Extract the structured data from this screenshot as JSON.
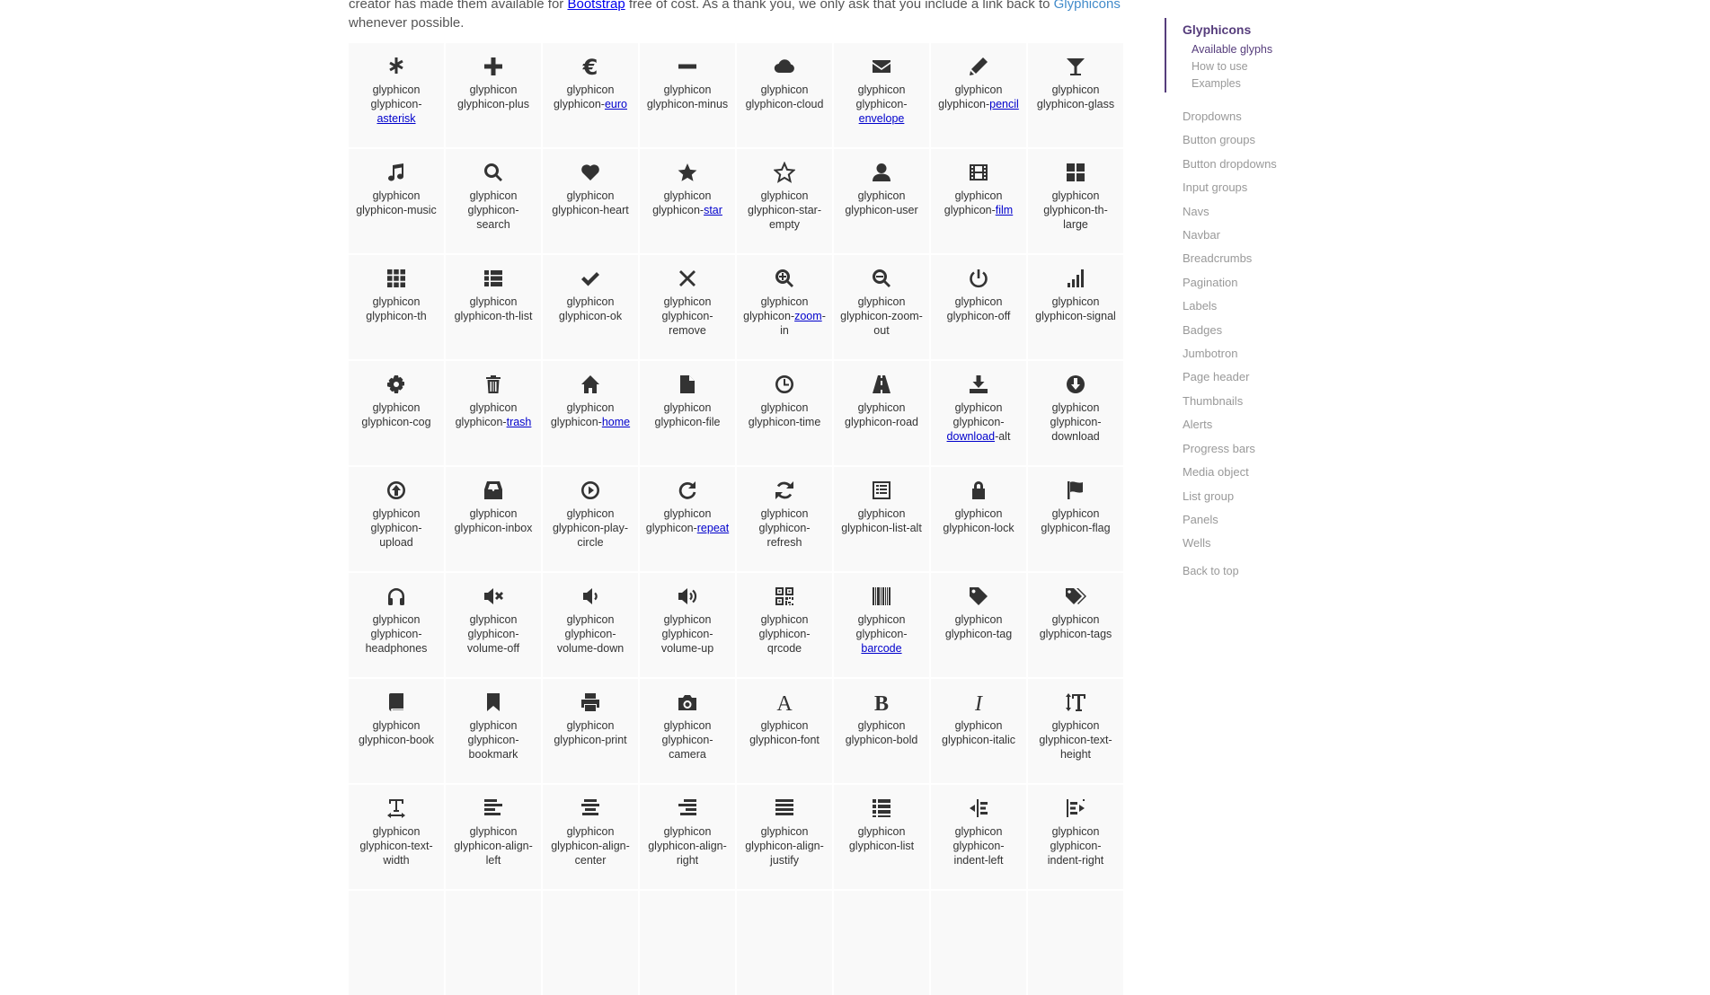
{
  "intro": {
    "pre": "creator has made them available for ",
    "bootstrap": "Bootstrap",
    "mid": " free of cost. As a thank you, we only ask that you include a link back to ",
    "glyphicons": "Glyphicons",
    "post": "whenever possible."
  },
  "glyphs": [
    {
      "icon": "asterisk",
      "pre": "glyphicon glyphicon-",
      "link": "asterisk",
      "post": ""
    },
    {
      "icon": "plus",
      "pre": "glyphicon glyphicon-plus",
      "link": "",
      "post": ""
    },
    {
      "icon": "euro",
      "pre": "glyphicon glyphicon-",
      "link": "euro",
      "post": ""
    },
    {
      "icon": "minus",
      "pre": "glyphicon glyphicon-minus",
      "link": "",
      "post": ""
    },
    {
      "icon": "cloud",
      "pre": "glyphicon glyphicon-cloud",
      "link": "",
      "post": ""
    },
    {
      "icon": "envelope",
      "pre": "glyphicon glyphicon-",
      "link": "envelope",
      "post": ""
    },
    {
      "icon": "pencil",
      "pre": "glyphicon glyphicon-",
      "link": "pencil",
      "post": ""
    },
    {
      "icon": "glass",
      "pre": "glyphicon glyphicon-glass",
      "link": "",
      "post": ""
    },
    {
      "icon": "music",
      "pre": "glyphicon glyphicon-music",
      "link": "",
      "post": ""
    },
    {
      "icon": "search",
      "pre": "glyphicon glyphicon-search",
      "link": "",
      "post": ""
    },
    {
      "icon": "heart",
      "pre": "glyphicon glyphicon-heart",
      "link": "",
      "post": ""
    },
    {
      "icon": "star",
      "pre": "glyphicon glyphicon-",
      "link": "star",
      "post": ""
    },
    {
      "icon": "star-empty",
      "pre": "glyphicon glyphicon-star-empty",
      "link": "",
      "post": ""
    },
    {
      "icon": "user",
      "pre": "glyphicon glyphicon-user",
      "link": "",
      "post": ""
    },
    {
      "icon": "film",
      "pre": "glyphicon glyphicon-",
      "link": "film",
      "post": ""
    },
    {
      "icon": "th-large",
      "pre": "glyphicon glyphicon-th-large",
      "link": "",
      "post": ""
    },
    {
      "icon": "th",
      "pre": "glyphicon glyphicon-th",
      "link": "",
      "post": ""
    },
    {
      "icon": "th-list",
      "pre": "glyphicon glyphicon-th-list",
      "link": "",
      "post": ""
    },
    {
      "icon": "ok",
      "pre": "glyphicon glyphicon-ok",
      "link": "",
      "post": ""
    },
    {
      "icon": "remove",
      "pre": "glyphicon glyphicon-remove",
      "link": "",
      "post": ""
    },
    {
      "icon": "zoom-in",
      "pre": "glyphicon glyphicon-",
      "link": "zoom",
      "post": "-in"
    },
    {
      "icon": "zoom-out",
      "pre": "glyphicon glyphicon-zoom-out",
      "link": "",
      "post": ""
    },
    {
      "icon": "off",
      "pre": "glyphicon glyphicon-off",
      "link": "",
      "post": ""
    },
    {
      "icon": "signal",
      "pre": "glyphicon glyphicon-signal",
      "link": "",
      "post": ""
    },
    {
      "icon": "cog",
      "pre": "glyphicon glyphicon-cog",
      "link": "",
      "post": ""
    },
    {
      "icon": "trash",
      "pre": "glyphicon glyphicon-",
      "link": "trash",
      "post": ""
    },
    {
      "icon": "home",
      "pre": "glyphicon glyphicon-",
      "link": "home",
      "post": ""
    },
    {
      "icon": "file",
      "pre": "glyphicon glyphicon-file",
      "link": "",
      "post": ""
    },
    {
      "icon": "time",
      "pre": "glyphicon glyphicon-time",
      "link": "",
      "post": ""
    },
    {
      "icon": "road",
      "pre": "glyphicon glyphicon-road",
      "link": "",
      "post": ""
    },
    {
      "icon": "download-alt",
      "pre": "glyphicon glyphicon-",
      "link": "download",
      "post": "-alt"
    },
    {
      "icon": "download",
      "pre": "glyphicon glyphicon-download",
      "link": "",
      "post": ""
    },
    {
      "icon": "upload",
      "pre": "glyphicon glyphicon-upload",
      "link": "",
      "post": ""
    },
    {
      "icon": "inbox",
      "pre": "glyphicon glyphicon-inbox",
      "link": "",
      "post": ""
    },
    {
      "icon": "play-circle",
      "pre": "glyphicon glyphicon-play-circle",
      "link": "",
      "post": ""
    },
    {
      "icon": "repeat",
      "pre": "glyphicon glyphicon-",
      "link": "repeat",
      "post": ""
    },
    {
      "icon": "refresh",
      "pre": "glyphicon glyphicon-refresh",
      "link": "",
      "post": ""
    },
    {
      "icon": "list-alt",
      "pre": "glyphicon glyphicon-list-alt",
      "link": "",
      "post": ""
    },
    {
      "icon": "lock",
      "pre": "glyphicon glyphicon-lock",
      "link": "",
      "post": ""
    },
    {
      "icon": "flag",
      "pre": "glyphicon glyphicon-flag",
      "link": "",
      "post": ""
    },
    {
      "icon": "headphones",
      "pre": "glyphicon glyphicon-headphones",
      "link": "",
      "post": ""
    },
    {
      "icon": "volume-off",
      "pre": "glyphicon glyphicon-volume-off",
      "link": "",
      "post": ""
    },
    {
      "icon": "volume-down",
      "pre": "glyphicon glyphicon-volume-down",
      "link": "",
      "post": ""
    },
    {
      "icon": "volume-up",
      "pre": "glyphicon glyphicon-volume-up",
      "link": "",
      "post": ""
    },
    {
      "icon": "qrcode",
      "pre": "glyphicon glyphicon-qrcode",
      "link": "",
      "post": ""
    },
    {
      "icon": "barcode",
      "pre": "glyphicon glyphicon-",
      "link": "barcode",
      "post": ""
    },
    {
      "icon": "tag",
      "pre": "glyphicon glyphicon-tag",
      "link": "",
      "post": ""
    },
    {
      "icon": "tags",
      "pre": "glyphicon glyphicon-tags",
      "link": "",
      "post": ""
    },
    {
      "icon": "book",
      "pre": "glyphicon glyphicon-book",
      "link": "",
      "post": ""
    },
    {
      "icon": "bookmark",
      "pre": "glyphicon glyphicon-bookmark",
      "link": "",
      "post": ""
    },
    {
      "icon": "print",
      "pre": "glyphicon glyphicon-print",
      "link": "",
      "post": ""
    },
    {
      "icon": "camera",
      "pre": "glyphicon glyphicon-camera",
      "link": "",
      "post": ""
    },
    {
      "icon": "font",
      "pre": "glyphicon glyphicon-font",
      "link": "",
      "post": ""
    },
    {
      "icon": "bold",
      "pre": "glyphicon glyphicon-bold",
      "link": "",
      "post": ""
    },
    {
      "icon": "italic",
      "pre": "glyphicon glyphicon-italic",
      "link": "",
      "post": ""
    },
    {
      "icon": "text-height",
      "pre": "glyphicon glyphicon-text-height",
      "link": "",
      "post": ""
    },
    {
      "icon": "text-width",
      "pre": "glyphicon glyphicon-text-width",
      "link": "",
      "post": ""
    },
    {
      "icon": "align-left",
      "pre": "glyphicon glyphicon-align-left",
      "link": "",
      "post": ""
    },
    {
      "icon": "align-center",
      "pre": "glyphicon glyphicon-align-center",
      "link": "",
      "post": ""
    },
    {
      "icon": "align-right",
      "pre": "glyphicon glyphicon-align-right",
      "link": "",
      "post": ""
    },
    {
      "icon": "align-justify",
      "pre": "glyphicon glyphicon-align-justify",
      "link": "",
      "post": ""
    },
    {
      "icon": "list",
      "pre": "glyphicon glyphicon-list",
      "link": "",
      "post": ""
    },
    {
      "icon": "indent-left",
      "pre": "glyphicon glyphicon-indent-left",
      "link": "",
      "post": ""
    },
    {
      "icon": "indent-right",
      "pre": "glyphicon glyphicon-indent-right",
      "link": "",
      "post": ""
    }
  ],
  "sidenav": {
    "active": "Glyphicons",
    "sub": [
      "Available glyphs",
      "How to use",
      "Examples"
    ],
    "items": [
      "Dropdowns",
      "Button groups",
      "Button dropdowns",
      "Input groups",
      "Navs",
      "Navbar",
      "Breadcrumbs",
      "Pagination",
      "Labels",
      "Badges",
      "Jumbotron",
      "Page header",
      "Thumbnails",
      "Alerts",
      "Progress bars",
      "Media object",
      "List group",
      "Panels",
      "Wells"
    ],
    "back": "Back to top"
  },
  "colors": {
    "accent": "#563d7c",
    "link": "#428bca",
    "cell_bg": "#f9f9f9"
  }
}
